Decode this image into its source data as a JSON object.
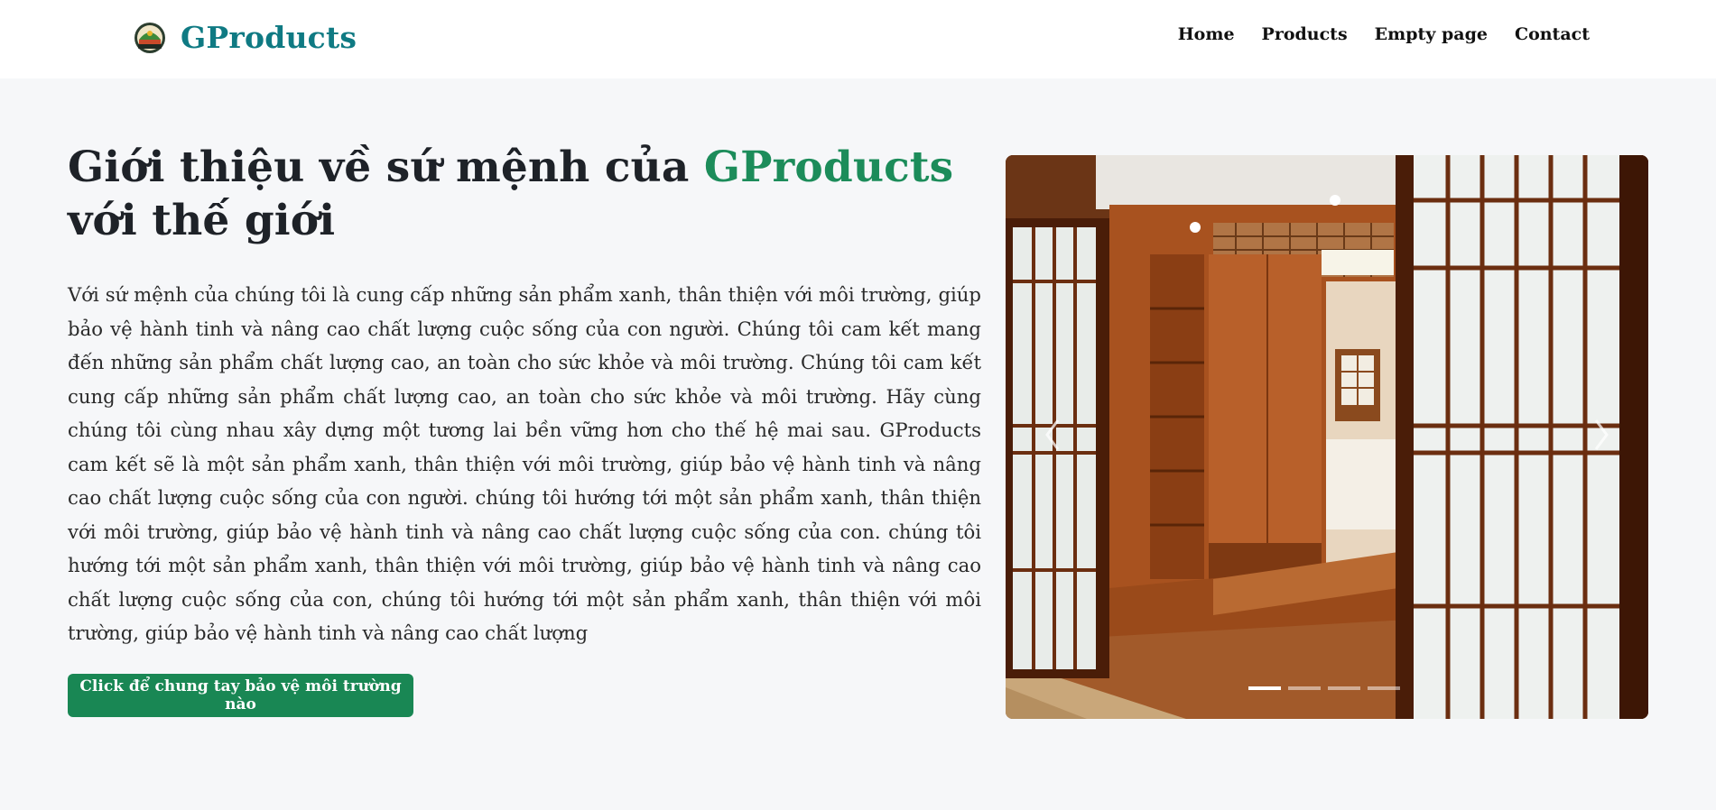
{
  "header": {
    "brand_name": "GProducts",
    "logo_icon": "gproducts-badge-logo",
    "nav": [
      {
        "label": "Home"
      },
      {
        "label": "Products"
      },
      {
        "label": "Empty page"
      },
      {
        "label": "Contact"
      }
    ]
  },
  "hero": {
    "title_before": "Giới thiệu về sứ mệnh của ",
    "title_accent": "GProducts",
    "title_after": " với thế giới",
    "body": "Với sứ mệnh của chúng tôi là cung cấp những sản phẩm xanh, thân thiện với môi trường, giúp bảo vệ hành tinh và nâng cao chất lượng cuộc sống của con người. Chúng tôi cam kết mang đến những sản phẩm chất lượng cao, an toàn cho sức khỏe và môi trường. Chúng tôi cam kết cung cấp những sản phẩm chất lượng cao, an toàn cho sức khỏe và môi trường. Hãy cùng chúng tôi cùng nhau xây dựng một tương lai bền vững hơn cho thế hệ mai sau. GProducts cam kết sẽ là một sản phẩm xanh, thân thiện với môi trường, giúp bảo vệ hành tinh và nâng cao chất lượng cuộc sống của con người. chúng tôi hướng tới một sản phẩm xanh, thân thiện với môi trường, giúp bảo vệ hành tinh và nâng cao chất lượng cuộc sống của con. chúng tôi hướng tới một sản phẩm xanh, thân thiện với môi trường, giúp bảo vệ hành tinh và nâng cao chất lượng cuộc sống của con, chúng tôi hướng tới một sản phẩm xanh, thân thiện với môi trường, giúp bảo vệ hành tinh và nâng cao chất lượng",
    "cta_label": "Click để chung tay bảo vệ môi trường nào"
  },
  "carousel": {
    "image_subject": "japanese-style-wooden-room-with-sliding-shoji-doors",
    "prev_icon": "chevron-left-icon",
    "next_icon": "chevron-right-icon",
    "slide_count": 4,
    "active_slide": 1
  },
  "colors": {
    "brand": "#0f7a83",
    "accent": "#1c8c5a",
    "button": "#198754",
    "page_background": "#f6f7f9",
    "header_background": "#ffffff"
  }
}
